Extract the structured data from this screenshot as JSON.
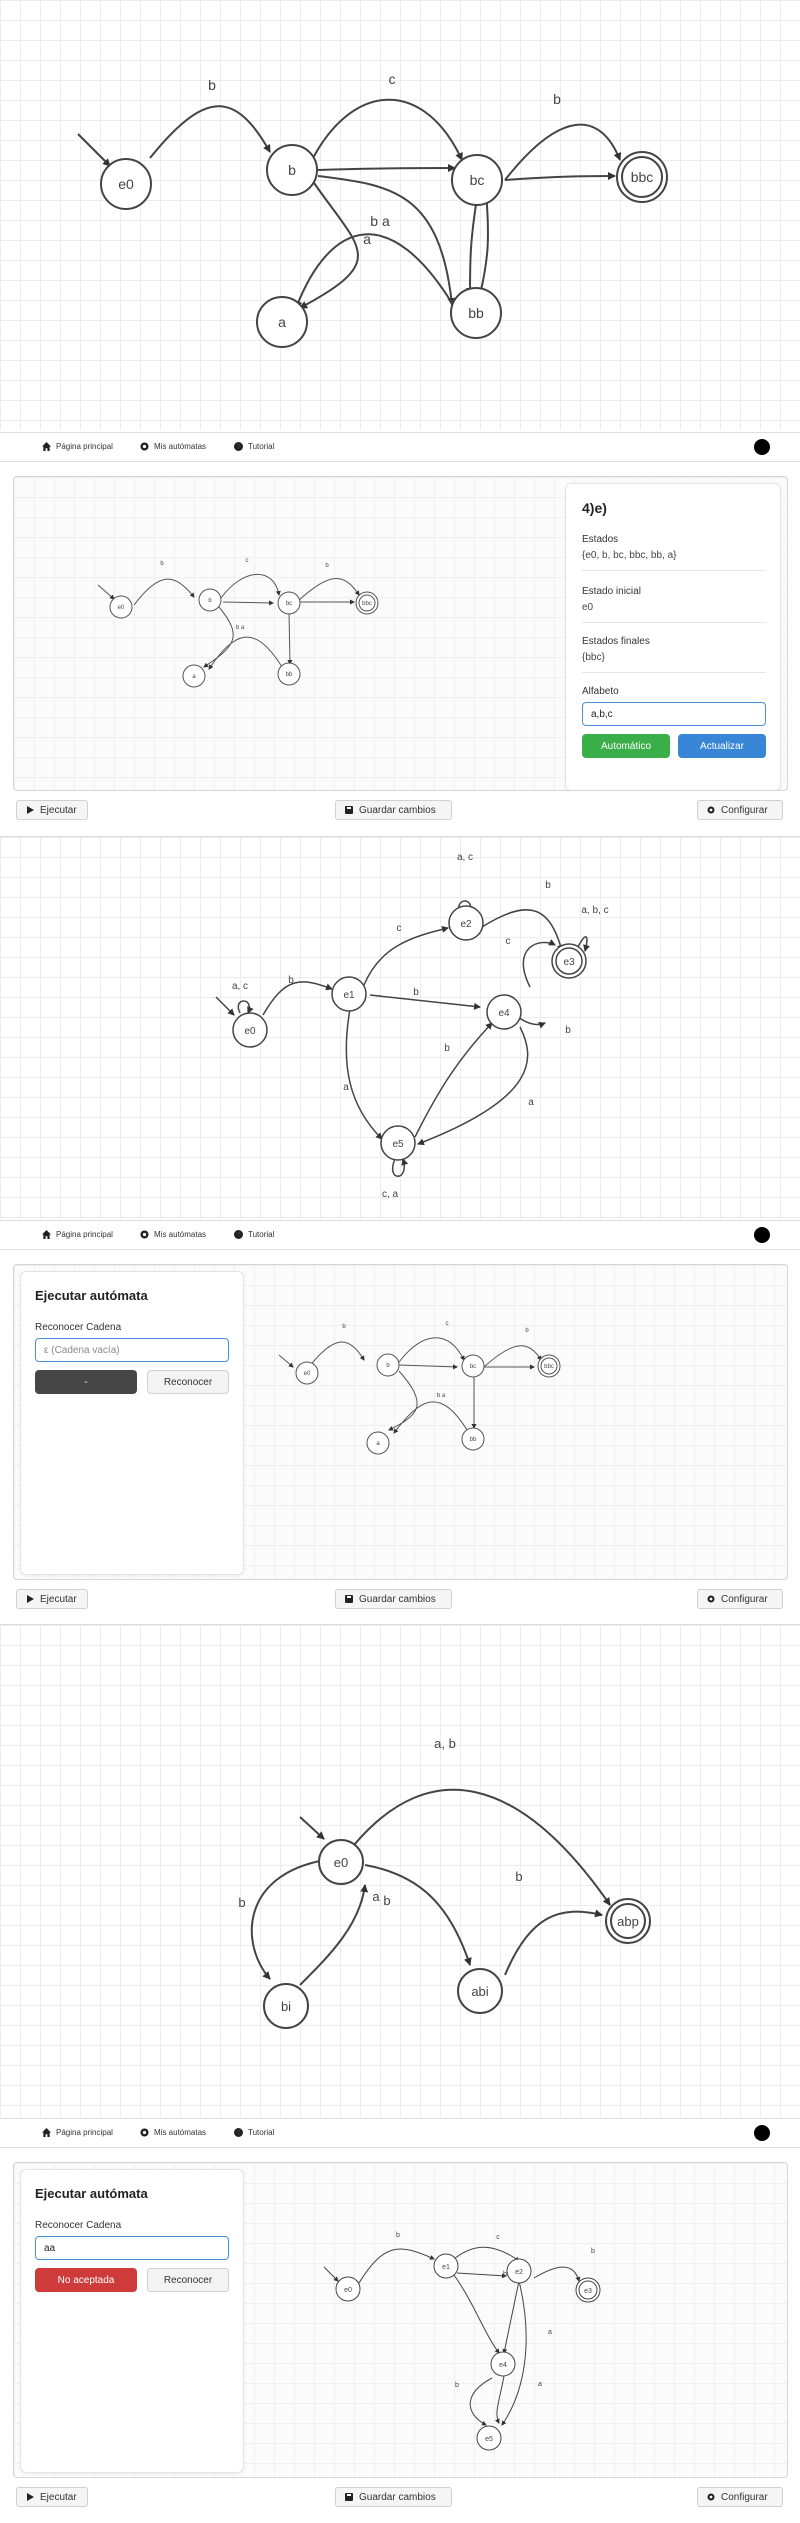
{
  "nav": {
    "home": "Página principal",
    "my_automata": "Mis autómatas",
    "tutorial": "Tutorial"
  },
  "toolbar": {
    "run": "Ejecutar",
    "save": "Guardar cambios",
    "configure": "Configurar"
  },
  "automaton_bbc": {
    "states": [
      "e0",
      "b",
      "bc",
      "bbc",
      "bb",
      "a"
    ],
    "edge_labels": [
      "b",
      "c",
      "b",
      "b a",
      "a"
    ]
  },
  "automaton_e": {
    "states": [
      "e0",
      "e1",
      "e2",
      "e3",
      "e4",
      "e5"
    ],
    "edge_labels": [
      "a, c",
      "b",
      "c",
      "a, c",
      "b",
      "a, b, c",
      "c",
      "b",
      "b",
      "b",
      "a",
      "a",
      "c, a"
    ]
  },
  "automaton_abp": {
    "states": [
      "e0",
      "abp",
      "bi",
      "abi"
    ],
    "edge_labels": [
      "a, b",
      "b",
      "a",
      "b",
      "b"
    ]
  },
  "automaton_small": {
    "states": [
      "e0",
      "e1",
      "e2",
      "e3",
      "e4",
      "e5"
    ],
    "edge_labels": [
      "b",
      "c",
      "b",
      "b",
      "a",
      "b",
      "a"
    ]
  },
  "info_card": {
    "title": "4)e)",
    "states_label": "Estados",
    "states_value": "{e0, b, bc, bbc, bb, a}",
    "initial_label": "Estado inicial",
    "initial_value": "e0",
    "final_label": "Estados finales",
    "final_value": "{bbc}",
    "alphabet_label": "Alfabeto",
    "alphabet_value": "a,b,c",
    "auto_button": "Automático",
    "update_button": "Actualizar"
  },
  "run_card_1": {
    "title": "Ejecutar autómata",
    "recognize_label": "Reconocer Cadena",
    "input_placeholder": "ε (Cadena vacía)",
    "result": "-",
    "recognize_button": "Reconocer"
  },
  "run_card_2": {
    "title": "Ejecutar autómata",
    "recognize_label": "Reconocer Cadena",
    "input_value": "aa",
    "result": "No aceptada",
    "recognize_button": "Reconocer"
  },
  "colors": {
    "auto_button": "#3aae48",
    "update_button": "#3a86d6",
    "result_neutral": "#464646",
    "result_rejected": "#cf3b3b",
    "input_border": "#4a90d9"
  }
}
